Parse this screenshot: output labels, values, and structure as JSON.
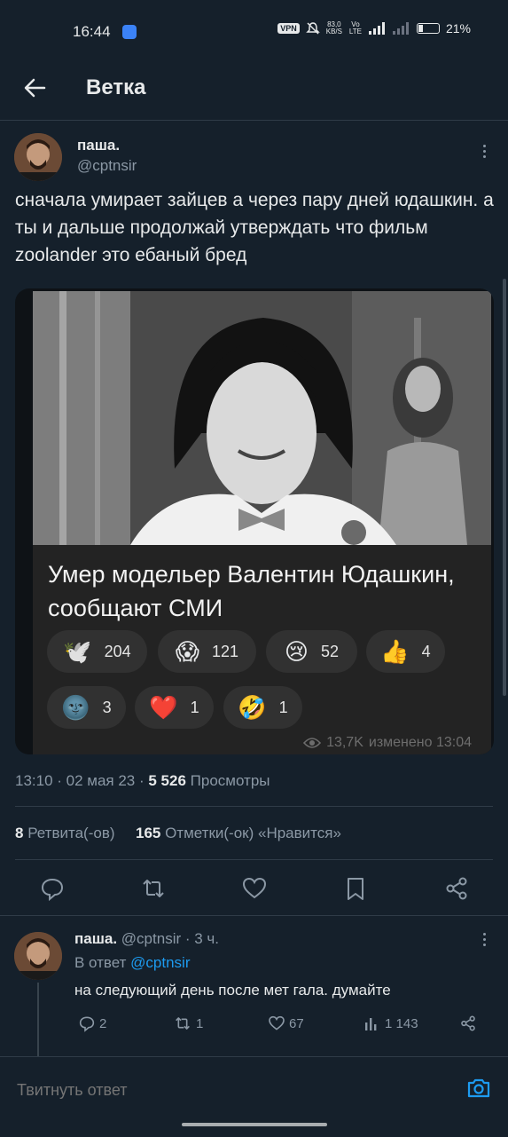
{
  "status_bar": {
    "time": "16:44",
    "vpn": "VPN",
    "speed_value": "83,0",
    "speed_unit": "KB/S",
    "volte": "Vo LTE",
    "network": "4G",
    "battery": "21%"
  },
  "header": {
    "title": "Ветка"
  },
  "tweet": {
    "name": "паша.",
    "handle": "@cptnsir",
    "text": "сначала умирает зайцев а через пару дней юдашкин. а ты и дальше продолжай утверждать что фильм zoolander это ебаный бред",
    "card": {
      "headline": "Умер модельер Валентин Юдашкин, сообщают СМИ",
      "reactions": [
        {
          "emoji": "🕊️",
          "count": "204"
        },
        {
          "emoji": "😱",
          "count": "121"
        },
        {
          "emoji": "😢",
          "count": "52"
        },
        {
          "emoji": "👍",
          "count": "4"
        },
        {
          "emoji": "🌚",
          "count": "3"
        },
        {
          "emoji": "❤️",
          "count": "1"
        },
        {
          "emoji": "🤣",
          "count": "1"
        }
      ],
      "views": "13,7K",
      "edited": "изменено 13:04"
    },
    "timestamp": "13:10 · 02 мая 23 · ",
    "views_count": "5 526",
    "views_label": " Просмотры",
    "retweets_count": "8",
    "retweets_label": " Ретвита(-ов)",
    "likes_count": "165",
    "likes_label": " Отметки(-ок) «Нравится»"
  },
  "reply": {
    "name": "паша.",
    "handle_time": " @cptnsir · 3 ч.",
    "reply_prefix": "В ответ ",
    "reply_to": "@cptnsir",
    "text": "на следующий день после мет гала. думайте",
    "replies": "2",
    "retweets": "1",
    "likes": "67",
    "views": "1 143"
  },
  "compose": {
    "placeholder": "Твитнуть ответ"
  },
  "colors": {
    "accent": "#1d9bf0",
    "background": "#15202b",
    "muted": "#8b98a5"
  }
}
